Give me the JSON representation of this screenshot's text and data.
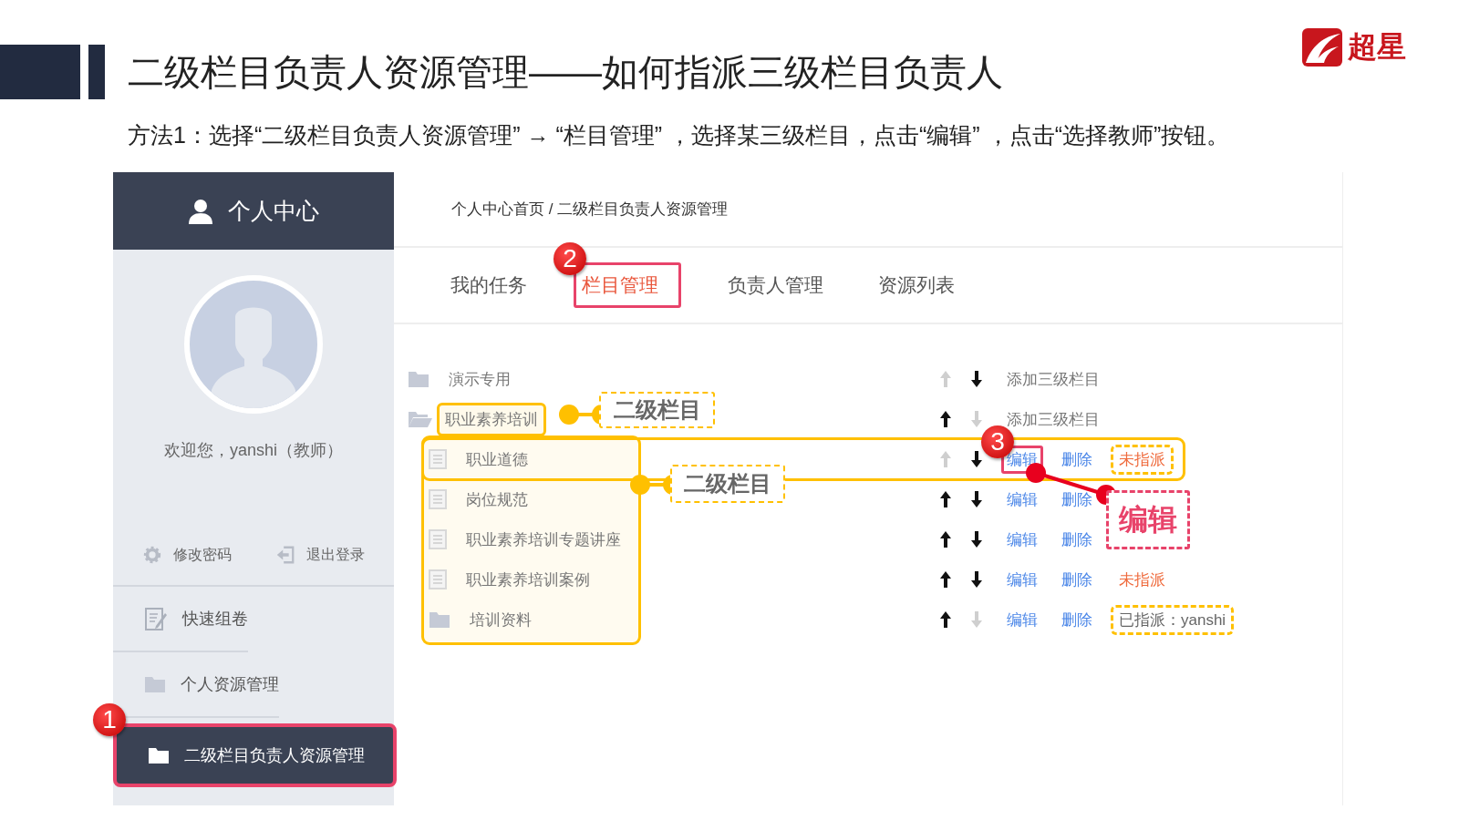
{
  "slide": {
    "title": "二级栏目负责人资源管理——如何指派三级栏目负责人",
    "subtitle": "方法1：选择“二级栏目负责人资源管理” → “栏目管理” ，选择某三级栏目，点击“编辑” ，点击“选择教师”按钮。",
    "logo_text": "超星"
  },
  "sidebar": {
    "title": "个人中心",
    "welcome": "欢迎您，yanshi（教师）",
    "links": [
      {
        "label": "修改密码"
      },
      {
        "label": "退出登录"
      }
    ],
    "menu": [
      {
        "label": "快速组卷",
        "selected": false
      },
      {
        "label": "个人资源管理",
        "selected": false
      },
      {
        "label": "二级栏目负责人资源管理",
        "selected": true,
        "highlighted": true,
        "step": "1"
      }
    ]
  },
  "breadcrumb": "个人中心首页 / 二级栏目负责人资源管理",
  "tabs": [
    {
      "label": "我的任务",
      "selected": false
    },
    {
      "label": "栏目管理",
      "selected": true,
      "highlighted": true,
      "step": "2"
    },
    {
      "label": "负责人管理",
      "selected": false
    },
    {
      "label": "资源列表",
      "selected": false
    }
  ],
  "tree": [
    {
      "label": "演示专用",
      "kind": "folder",
      "expanded": false,
      "up_enabled": false,
      "down_enabled": true,
      "actions": [
        {
          "label": "添加三级栏目",
          "kind": "plain"
        }
      ]
    },
    {
      "label": "职业素养培训",
      "kind": "folder",
      "expanded": true,
      "highlighted": true,
      "children_highlighted": true,
      "up_enabled": true,
      "down_enabled": false,
      "actions": [
        {
          "label": "添加三级栏目",
          "kind": "plain"
        }
      ],
      "children": [
        {
          "label": "职业道德",
          "kind": "page",
          "row_highlighted": true,
          "up_enabled": false,
          "down_enabled": true,
          "actions": [
            {
              "label": "编辑",
              "kind": "link",
              "highlighted": true,
              "step": "3"
            },
            {
              "label": "删除",
              "kind": "link"
            }
          ],
          "status": {
            "text": "未指派",
            "kind": "unassigned",
            "highlighted": true
          }
        },
        {
          "label": "岗位规范",
          "kind": "page",
          "up_enabled": true,
          "down_enabled": true,
          "actions": [
            {
              "label": "编辑",
              "kind": "link"
            },
            {
              "label": "删除",
              "kind": "link"
            }
          ]
        },
        {
          "label": "职业素养培训专题讲座",
          "kind": "page",
          "up_enabled": true,
          "down_enabled": true,
          "actions": [
            {
              "label": "编辑",
              "kind": "link"
            },
            {
              "label": "删除",
              "kind": "link"
            }
          ]
        },
        {
          "label": "职业素养培训案例",
          "kind": "page",
          "up_enabled": true,
          "down_enabled": true,
          "actions": [
            {
              "label": "编辑",
              "kind": "link"
            },
            {
              "label": "删除",
              "kind": "link"
            }
          ],
          "status": {
            "text": "未指派",
            "kind": "unassigned"
          }
        },
        {
          "label": "培训资料",
          "kind": "folder",
          "expanded": false,
          "up_enabled": true,
          "down_enabled": false,
          "actions": [
            {
              "label": "编辑",
              "kind": "link"
            },
            {
              "label": "删除",
              "kind": "link"
            }
          ],
          "status": {
            "text": "已指派：yanshi",
            "kind": "assigned",
            "highlighted": true
          }
        }
      ]
    }
  ],
  "callouts": [
    {
      "text": "二级栏目",
      "kind": "yellow"
    },
    {
      "text": "二级栏目",
      "kind": "yellow"
    },
    {
      "text": "编辑",
      "kind": "pink"
    }
  ]
}
